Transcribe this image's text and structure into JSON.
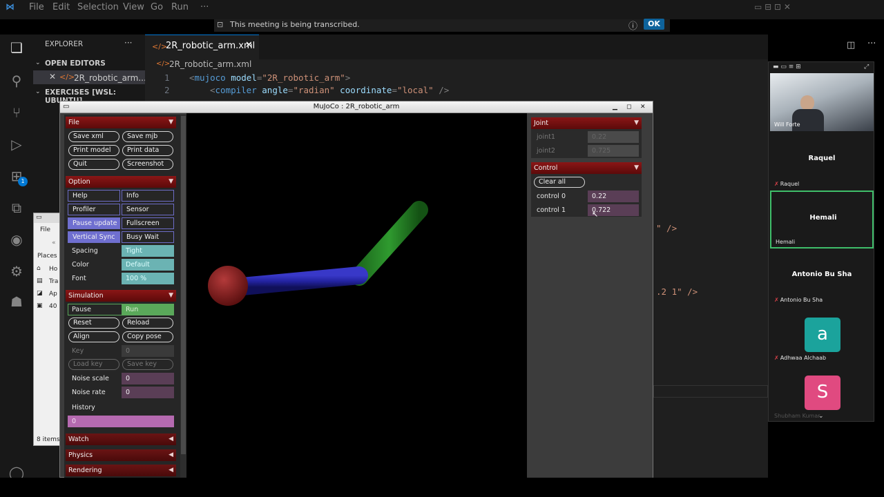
{
  "vscode": {
    "menu": [
      "File",
      "Edit",
      "Selection",
      "View",
      "Go",
      "Run",
      "···"
    ],
    "notification": "This meeting is being transcribed.",
    "notification_ok": "OK",
    "explorer": {
      "title": "EXPLORER",
      "open_editors": "OPEN EDITORS",
      "open_file": "2R_robotic_arm....",
      "workspace": "EXERCISES [WSL: UBUNTU]"
    },
    "tab": "2R_robotic_arm.xml",
    "breadcrumb": "2R_robotic_arm.xml",
    "code": {
      "line1_no": "1",
      "line2_no": "2",
      "l1_open": "<",
      "l1_tag": "mujoco",
      "l1_attr": " model",
      "l1_eq": "=",
      "l1_val": "\"2R_robotic_arm\"",
      "l1_close": ">",
      "l2_open": "<",
      "l2_tag": "compiler",
      "l2_attr1": " angle",
      "l2_val1": "\"radian\"",
      "l2_attr2": " coordinate",
      "l2_val2": "\"local\"",
      "l2_close": " />",
      "frag1": "\" />",
      "frag2": ".2 1\" />"
    },
    "badge": "1"
  },
  "files_window": {
    "menu": "File",
    "places": "Places",
    "items": [
      "Ho",
      "Tra",
      "Ap",
      "40"
    ],
    "count": "8 items"
  },
  "zoom": {
    "participants": [
      {
        "name": "Will Forte"
      },
      {
        "name": "Raquel"
      },
      {
        "name": "Hemali"
      },
      {
        "name": "Antonio Bu Sha"
      },
      {
        "name": "Adhwaa Alchaab",
        "initial": "a"
      },
      {
        "name": "Shubham Kumar",
        "initial": "S"
      }
    ],
    "colors": {
      "active_border": "#3fbf6a",
      "avatar_a": "#1ba39c",
      "avatar_s": "#e04a80"
    }
  },
  "mujoco": {
    "title": "MuJoCo : 2R_robotic_arm",
    "file": {
      "header": "File",
      "buttons": [
        "Save xml",
        "Save mjb",
        "Print model",
        "Print data",
        "Quit",
        "Screenshot"
      ]
    },
    "option": {
      "header": "Option",
      "buttons": [
        "Help",
        "Info",
        "Profiler",
        "Sensor",
        "Pause update",
        "Fullscreen",
        "Vertical Sync",
        "Busy Wait"
      ],
      "spacing_label": "Spacing",
      "spacing_value": "Tight",
      "color_label": "Color",
      "color_value": "Default",
      "font_label": "Font",
      "font_value": "100 %"
    },
    "simulation": {
      "header": "Simulation",
      "pause": "Pause",
      "run": "Run",
      "buttons": [
        "Reset",
        "Reload",
        "Align",
        "Copy pose",
        "Load key",
        "Save key"
      ],
      "key_label": "Key",
      "key_value": "0",
      "noise_scale_label": "Noise scale",
      "noise_scale_value": "0",
      "noise_rate_label": "Noise rate",
      "noise_rate_value": "0",
      "history_label": "History",
      "history_value": "0"
    },
    "collapsed": [
      "Watch",
      "Physics",
      "Rendering"
    ],
    "joint": {
      "header": "Joint",
      "rows": [
        {
          "label": "joint1",
          "value": "0.22"
        },
        {
          "label": "joint2",
          "value": "0.725"
        }
      ]
    },
    "control": {
      "header": "Control",
      "clear": "Clear all",
      "rows": [
        {
          "label": "control 0",
          "value": "0.22"
        },
        {
          "label": "control 1",
          "value": "0.722"
        }
      ]
    },
    "colors": {
      "header_red": "#7a1010",
      "toggle_on": "#6f6fd0",
      "run_green": "#5aa85a",
      "select_teal": "#6bb3b3",
      "slider_purple": "#5a3e56"
    }
  }
}
